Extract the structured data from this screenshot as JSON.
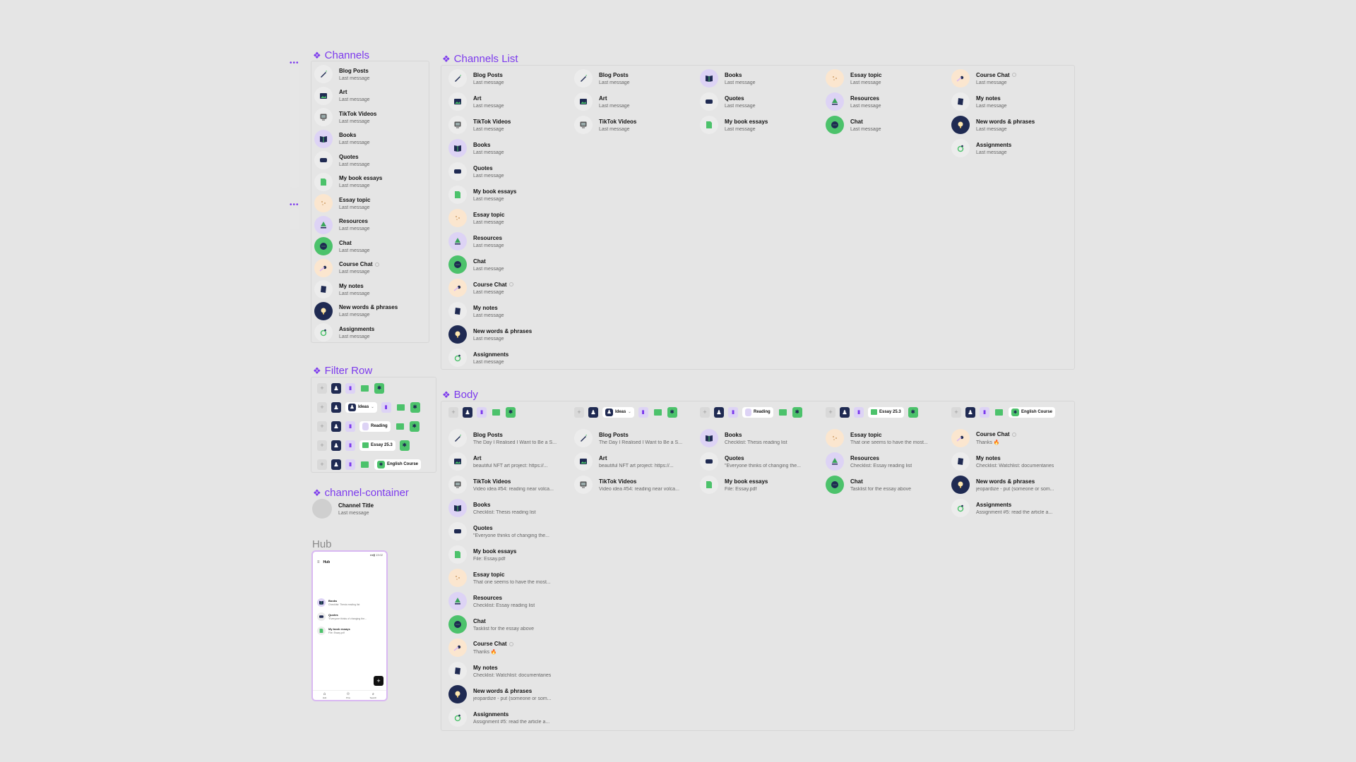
{
  "sections": {
    "channels": "Channels",
    "channels_list": "Channels List",
    "filter_row": "Filter Row",
    "channel_container": "channel-container",
    "hub": "Hub",
    "body": "Body"
  },
  "channels": [
    {
      "name": "Blog Posts",
      "last": "Last message",
      "icon": "pen-icon",
      "bg": "#ececec",
      "fg": "#1f2a52",
      "dot": false
    },
    {
      "name": "Art",
      "last": "Last message",
      "icon": "picture-icon",
      "bg": "#ececec",
      "fg": "#1f2a52",
      "dot": false
    },
    {
      "name": "TikTok Videos",
      "last": "Last message",
      "icon": "monitor-icon",
      "bg": "#ececec",
      "fg": "#555555",
      "dot": false
    },
    {
      "name": "Books",
      "last": "Last message",
      "icon": "book-icon",
      "bg": "#ddd3f5",
      "fg": "#1f2a52",
      "dot": false
    },
    {
      "name": "Quotes",
      "last": "Last message",
      "icon": "quote-bubble-icon",
      "bg": "#ececec",
      "fg": "#1f2a52",
      "dot": false
    },
    {
      "name": "My book essays",
      "last": "Last message",
      "icon": "document-icon",
      "bg": "#ececec",
      "fg": "#4cc26b",
      "dot": false
    },
    {
      "name": "Essay topic",
      "last": "Last message",
      "icon": "sparkle-icon",
      "bg": "#fbe6cf",
      "fg": "#d2a26b",
      "dot": false
    },
    {
      "name": "Resources",
      "last": "Last message",
      "icon": "tree-icon",
      "bg": "#ddd3f5",
      "fg": "#3aa55c",
      "dot": false
    },
    {
      "name": "Chat",
      "last": "Last message",
      "icon": "chat-bubble-icon",
      "bg": "#4cc26b",
      "fg": "#1f2a52",
      "dot": false
    },
    {
      "name": "Course Chat",
      "last": "Last message",
      "icon": "comet-icon",
      "bg": "#fbe6cf",
      "fg": "#1f2a52",
      "dot": true
    },
    {
      "name": "My notes",
      "last": "Last message",
      "icon": "notebook-icon",
      "bg": "#ececec",
      "fg": "#1f2a52",
      "dot": false
    },
    {
      "name": "New words & phrases",
      "last": "Last message",
      "icon": "lightbulb-icon",
      "bg": "#1f2a52",
      "fg": "#fde7b0",
      "dot": false
    },
    {
      "name": "Assignments",
      "last": "Last message",
      "icon": "ring-icon",
      "bg": "#ececec",
      "fg": "#4cc26b",
      "dot": false
    }
  ],
  "body_previews": [
    "The Day I Realised I Want to Be a S...",
    "beautiful NFT art project: https://...",
    "Video idea #54: reading near volca...",
    "Checklist: Thesis reading list",
    "\"Everyone thinks of changing the...",
    "File: Essay.pdf",
    "That one seems to have the most...",
    "Checklist: Essay reading list",
    "Tasklist for the essay above",
    "Thanks 🔥",
    "Checklist: Watchlist: documentaries",
    "jeopardize - put (someone or som...",
    "Assignment #5: read the article a..."
  ],
  "filter_labels": {
    "ideas": "Ideas",
    "reading": "Reading",
    "essay": "Essay 25.3",
    "english": "English Course",
    "plus": "+"
  },
  "channel_container": {
    "title": "Channel Title",
    "last": "Last message"
  },
  "hub": {
    "status": "●●▮ 13:02",
    "title": "Hub",
    "items": [
      {
        "name": "Books",
        "last": "Checklist: Thesis reading list"
      },
      {
        "name": "Quotes",
        "last": "\"Everyone thinks of changing the..."
      },
      {
        "name": "My book essays",
        "last": "File: Essay.pdf"
      }
    ],
    "nav": [
      "Hub",
      "Pins",
      "Search"
    ],
    "fab": "+"
  },
  "colors": {
    "accent": "#7c3aed",
    "navy": "#1f2a52",
    "green": "#4cc26b",
    "lavender": "#ddd3f5",
    "peach": "#fbe6cf"
  }
}
